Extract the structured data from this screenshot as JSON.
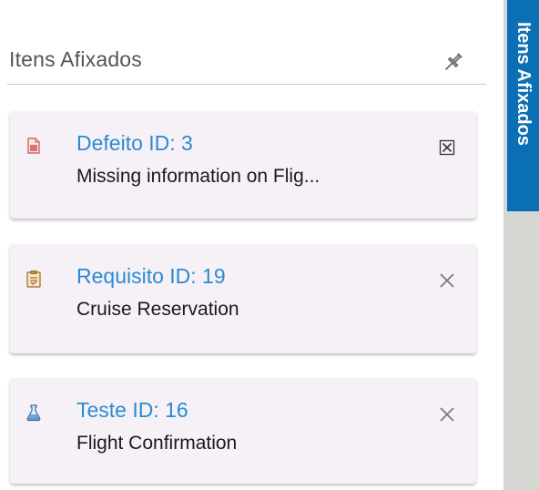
{
  "panel": {
    "title": "Itens Afixados",
    "pin_icon": "pin-icon"
  },
  "items": [
    {
      "type_icon": "defect-icon",
      "title": "Defeito ID: 3",
      "description": "Missing information on Flig...",
      "close_icon": "close-box-icon"
    },
    {
      "type_icon": "requirement-icon",
      "title": "Requisito ID: 19",
      "description": "Cruise Reservation",
      "close_icon": "close-icon"
    },
    {
      "type_icon": "test-icon",
      "title": "Teste ID: 16",
      "description": "Flight Confirmation",
      "close_icon": "close-icon"
    }
  ],
  "side_tab": {
    "label": "Itens Afixados"
  },
  "colors": {
    "link": "#2a8bd2",
    "card_bg": "#f6f1f6",
    "tab_bg": "#0a6fb4",
    "rail_bg": "#d4d7d2"
  }
}
